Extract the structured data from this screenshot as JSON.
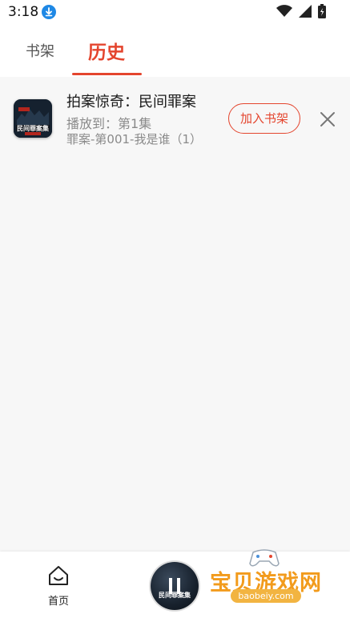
{
  "status_bar": {
    "time": "3:18"
  },
  "tabs": [
    {
      "label": "书架",
      "active": false
    },
    {
      "label": "历史",
      "active": true
    }
  ],
  "history": {
    "items": [
      {
        "title": "拍案惊奇：民间罪案",
        "progress": "播放到：第1集",
        "episode": "罪案-第001-我是谁（1）",
        "add_button": "加入书架",
        "cover_text": "民间罪案集"
      }
    ]
  },
  "bottom_nav": {
    "home_label": "首页",
    "player_cover_text": "民间罪案集"
  },
  "watermark": {
    "text": "宝贝游戏网",
    "url": "baobeiy.com"
  },
  "colors": {
    "accent": "#e4452e",
    "secondary_text": "#8a8a8a",
    "background": "#f7f7f7",
    "watermark": "#f29b1c"
  }
}
